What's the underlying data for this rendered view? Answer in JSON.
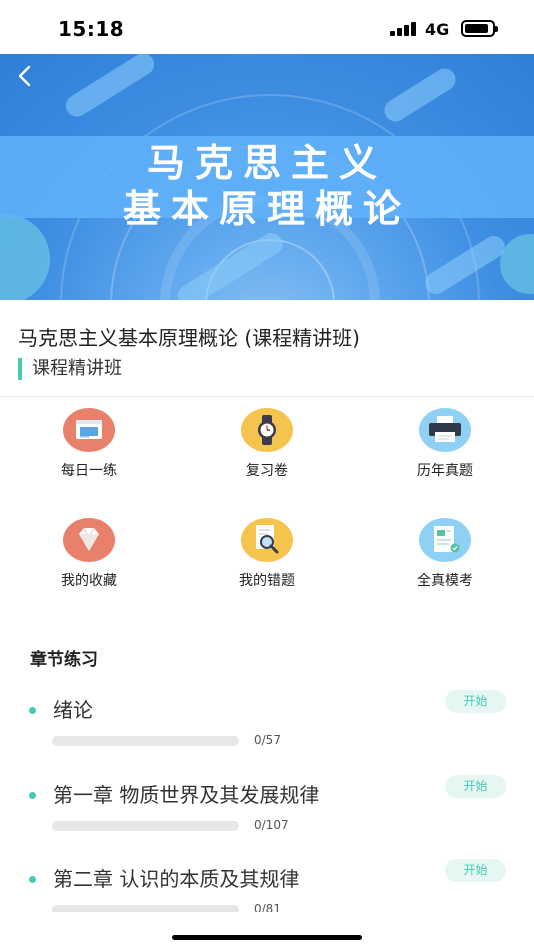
{
  "status_bar": {
    "time": "15:18",
    "network": "4G",
    "battery_level": 0.9
  },
  "banner": {
    "title_line1": "马克思主义",
    "title_line2": "基本原理概论",
    "back_icon": "chevron-left-icon"
  },
  "course": {
    "title": "马克思主义基本原理概论 (课程精讲班)",
    "tag": "课程精讲班",
    "accent_color": "#45c9b5"
  },
  "grid": [
    {
      "label": "每日一练",
      "icon": "browser-window-icon",
      "color": "#e8806b"
    },
    {
      "label": "复习卷",
      "icon": "watch-icon",
      "color": "#f5c44e"
    },
    {
      "label": "历年真题",
      "icon": "printer-icon",
      "color": "#8fd1f5"
    },
    {
      "label": "我的收藏",
      "icon": "diamond-icon",
      "color": "#e8806b"
    },
    {
      "label": "我的错题",
      "icon": "magnifier-document-icon",
      "color": "#f5c44e"
    },
    {
      "label": "全真模考",
      "icon": "exam-paper-icon",
      "color": "#8fd1f5"
    }
  ],
  "chapters_section": {
    "title": "章节练习",
    "start_label": "开始",
    "chapters": [
      {
        "name": "绪论",
        "progress": "0/57",
        "done_fraction": 0
      },
      {
        "name": "第一章 物质世界及其发展规律",
        "progress": "0/107",
        "done_fraction": 0
      },
      {
        "name": "第二章 认识的本质及其规律",
        "progress": "0/81",
        "done_fraction": 0
      }
    ]
  }
}
